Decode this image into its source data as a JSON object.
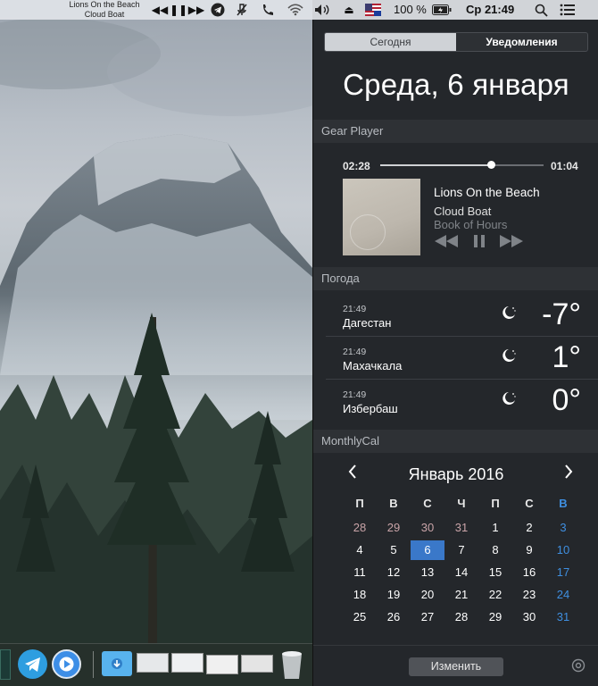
{
  "menubar": {
    "now_playing_title": "Lions On the Beach",
    "now_playing_artist": "Cloud Boat",
    "icons": [
      "rewind-icon",
      "pause-icon",
      "fast-forward-icon",
      "telegram-icon",
      "microphone-icon",
      "phone-icon",
      "wifi-icon",
      "volume-icon",
      "eject-icon",
      "flag-icon",
      "battery-icon",
      "search-icon",
      "list-icon"
    ],
    "battery_text": "100 %",
    "clock": "Ср 21:49"
  },
  "panel": {
    "tabs": [
      "Сегодня",
      "Уведомления"
    ],
    "date_heading": "Среда, 6 января",
    "player": {
      "header": "Gear Player",
      "elapsed": "02:28",
      "remaining": "01:04",
      "progress": 0.68,
      "title": "Lions On the Beach",
      "artist": "Cloud Boat",
      "album": "Book of Hours",
      "controls": [
        "rewind-icon",
        "pause-icon",
        "fast-forward-icon"
      ]
    },
    "weather": {
      "header": "Погода",
      "rows": [
        {
          "time": "21:49",
          "city": "Дагестан",
          "temp": "-7°",
          "icon": "moon-icon"
        },
        {
          "time": "21:49",
          "city": "Махачкала",
          "temp": "1°",
          "icon": "moon-icon"
        },
        {
          "time": "21:49",
          "city": "Избербаш",
          "temp": "0°",
          "icon": "moon-icon"
        }
      ]
    },
    "calendar": {
      "header": "MonthlyCal",
      "month_title": "Январь 2016",
      "weekdays": [
        "П",
        "В",
        "С",
        "Ч",
        "П",
        "С",
        "В"
      ],
      "weeks": [
        [
          "28",
          "29",
          "30",
          "31",
          "1",
          "2",
          "3"
        ],
        [
          "4",
          "5",
          "6",
          "7",
          "8",
          "9",
          "10"
        ],
        [
          "11",
          "12",
          "13",
          "14",
          "15",
          "16",
          "17"
        ],
        [
          "18",
          "19",
          "20",
          "21",
          "22",
          "23",
          "24"
        ],
        [
          "25",
          "26",
          "27",
          "28",
          "29",
          "30",
          "31"
        ]
      ],
      "today": "6",
      "prev_month_days": 4
    },
    "edit_button": "Изменить"
  },
  "colors": {
    "panel_bg": "#24272b",
    "accent": "#3a78c9",
    "sunday": "#3f8fe0",
    "other_month": "#c9a4a8"
  }
}
